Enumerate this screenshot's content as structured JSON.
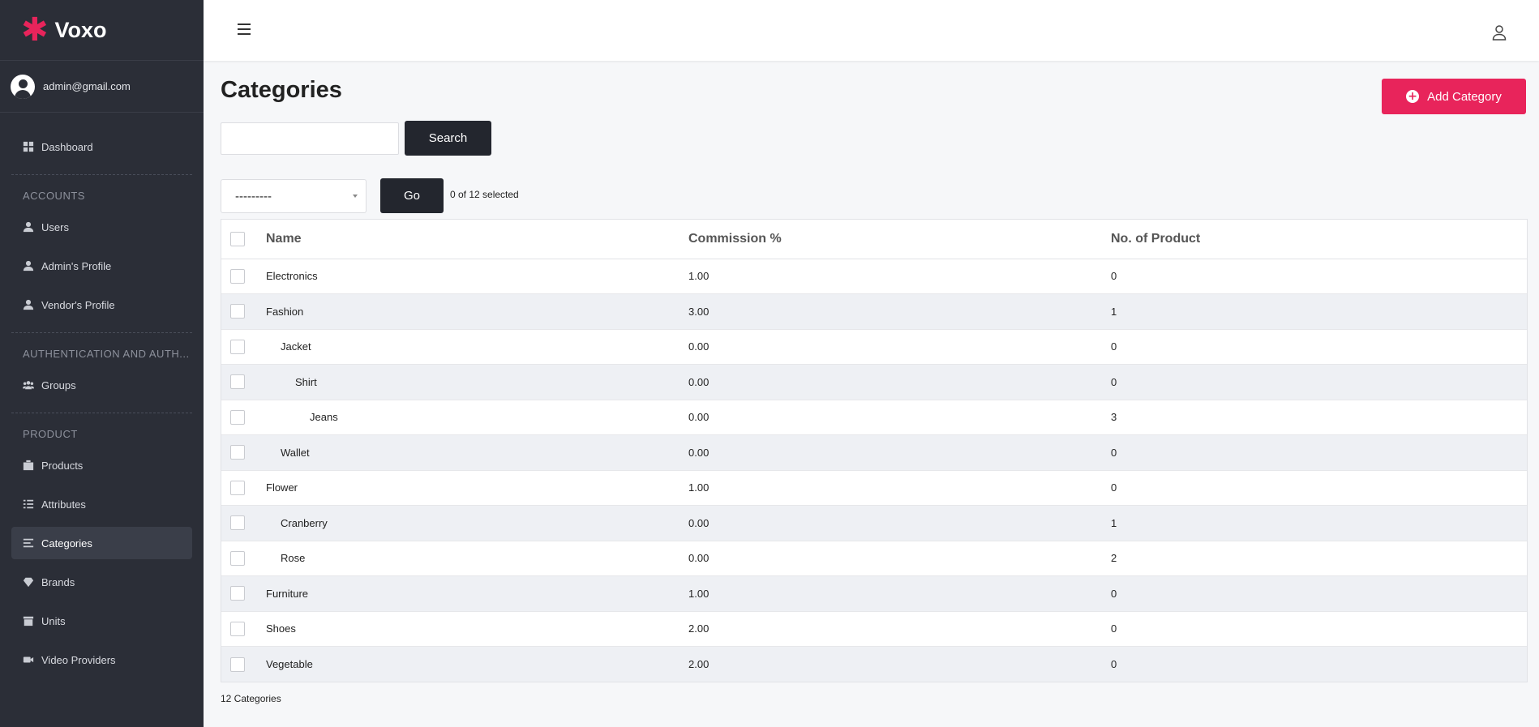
{
  "brand": {
    "name": "Voxo",
    "mark": "✱"
  },
  "user": {
    "email": "admin@gmail.com"
  },
  "sidebar": {
    "dashboard": "Dashboard",
    "accounts_header": "ACCOUNTS",
    "users": "Users",
    "admins_profile": "Admin's Profile",
    "vendors_profile": "Vendor's Profile",
    "auth_header": "AUTHENTICATION AND AUTH...",
    "groups": "Groups",
    "product_header": "PRODUCT",
    "products": "Products",
    "attributes": "Attributes",
    "categories": "Categories",
    "brands": "Brands",
    "units": "Units",
    "video_providers": "Video Providers"
  },
  "page": {
    "title": "Categories",
    "add_button": "Add Category",
    "search_button": "Search",
    "search_value": "",
    "action_select": "---------",
    "go_button": "Go",
    "selected_count": "0 of 12 selected",
    "footer_count": "12 Categories"
  },
  "table": {
    "headers": {
      "name": "Name",
      "commission": "Commission %",
      "products": "No. of Product"
    },
    "rows": [
      {
        "name": "Electronics",
        "level": 0,
        "commission": "1.00",
        "products": "0"
      },
      {
        "name": "Fashion",
        "level": 0,
        "commission": "3.00",
        "products": "1"
      },
      {
        "name": "Jacket",
        "level": 1,
        "commission": "0.00",
        "products": "0"
      },
      {
        "name": "Shirt",
        "level": 2,
        "commission": "0.00",
        "products": "0"
      },
      {
        "name": "Jeans",
        "level": 3,
        "commission": "0.00",
        "products": "3"
      },
      {
        "name": "Wallet",
        "level": 1,
        "commission": "0.00",
        "products": "0"
      },
      {
        "name": "Flower",
        "level": 0,
        "commission": "1.00",
        "products": "0"
      },
      {
        "name": "Cranberry",
        "level": 1,
        "commission": "0.00",
        "products": "1"
      },
      {
        "name": "Rose",
        "level": 1,
        "commission": "0.00",
        "products": "2"
      },
      {
        "name": "Furniture",
        "level": 0,
        "commission": "1.00",
        "products": "0"
      },
      {
        "name": "Shoes",
        "level": 0,
        "commission": "2.00",
        "products": "0"
      },
      {
        "name": "Vegetable",
        "level": 0,
        "commission": "2.00",
        "products": "0"
      }
    ]
  },
  "colors": {
    "accent": "#e8245b",
    "sidebar_bg": "#2b2e37",
    "dark_button": "#23262e"
  }
}
